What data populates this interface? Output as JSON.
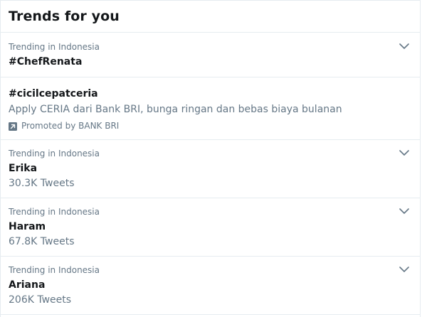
{
  "header": {
    "title": "Trends for you"
  },
  "trends": [
    {
      "context": "Trending in Indonesia",
      "name": "#ChefRenata"
    },
    {
      "name": "#cicilcepatceria",
      "description": "Apply CERIA dari Bank BRI, bunga ringan dan bebas biaya bulanan",
      "promoted": "Promoted by BANK BRI"
    },
    {
      "context": "Trending in Indonesia",
      "name": "Erika",
      "count": "30.3K Tweets"
    },
    {
      "context": "Trending in Indonesia",
      "name": "Haram",
      "count": "67.8K Tweets"
    },
    {
      "context": "Trending in Indonesia",
      "name": "Ariana",
      "count": "206K Tweets"
    }
  ],
  "icons": {
    "menu": "chevron-down-icon",
    "promoted": "promoted-arrow-icon"
  },
  "colors": {
    "text_primary": "#14171a",
    "text_secondary": "#657786",
    "divider": "#e6ecf0"
  }
}
